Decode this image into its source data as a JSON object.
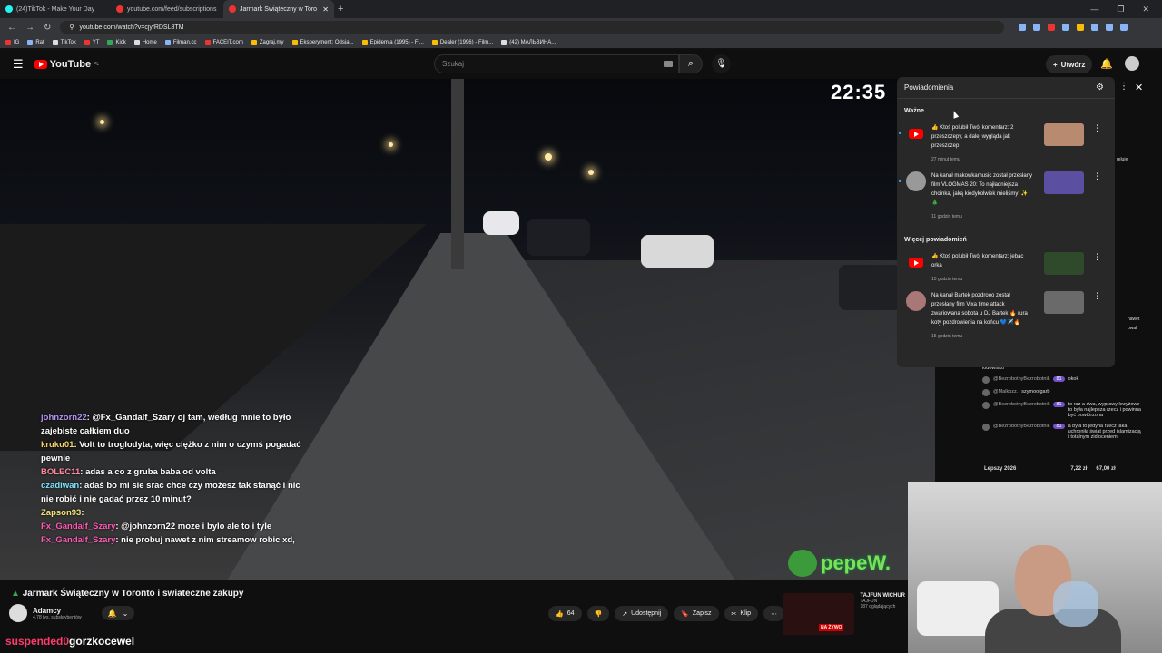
{
  "browser": {
    "tabs": [
      {
        "label": "(24)TikTok - Make Your Day",
        "active": false
      },
      {
        "label": "youtube.com/feed/subscriptions",
        "active": false
      },
      {
        "label": "Jarmark Świąteczny w Toro",
        "active": true
      }
    ],
    "url": "youtube.com/watch?v=cjyfRDSL8TM",
    "bookmarks": [
      "IG",
      "Rat",
      "TikTok",
      "YT",
      "Kick",
      "Home",
      "Filman.cc",
      "FACEIT.com",
      "Zagraj.my",
      "Eksperyment: Odsia...",
      "Epidemia (1995) - Fi...",
      "Dealer (1996) - Film...",
      "(42) МАЛЬВИНА..."
    ]
  },
  "youtube": {
    "logo": "YouTube",
    "region": "PL",
    "search_placeholder": "Szukaj",
    "create_label": "Utwórz"
  },
  "video": {
    "clock": "22:35",
    "title": "Jarmark Świąteczny w Toronto i swiateczne zakupy",
    "channel": "Adamcy",
    "subscribers": "4,78 tys. subskrybentów",
    "likes": "64",
    "share_label": "Udostępnij",
    "save_label": "Zapisz",
    "clip_label": "Klip",
    "pepe_text": "pepeW."
  },
  "stream_chat": [
    {
      "user": "johnzorn22",
      "msg": ": @Fx_Gandalf_Szary oj tam, według mnie to było zajebiste całkiem duo",
      "cls": "n1"
    },
    {
      "user": "kruku01",
      "msg": ": Volt to troglodyta, więc ciężko z nim o czymś pogadać pewnie",
      "cls": "n2"
    },
    {
      "user": "BOLEC11",
      "msg": ": adas a co z gruba baba od volta",
      "cls": "n3"
    },
    {
      "user": "czadiwan",
      "msg": ": adaś bo mi sie srac chce czy możesz tak stanąć i nic nie robić i nie gadać przez 10 minut?",
      "cls": "n4"
    },
    {
      "user": "Zapson93",
      "msg": ":",
      "cls": "n5"
    },
    {
      "user": "Fx_Gandalf_Szary",
      "msg": ": @johnzorn22 moze i bylo ale to i tyle",
      "cls": "n6"
    },
    {
      "user": "Fx_Gandalf_Szary",
      "msg": ": nie probuj nawet z nim streamow robic xd,",
      "cls": "n6"
    }
  ],
  "notifications": {
    "title": "Powiadomienia",
    "section_important": "Ważne",
    "section_more": "Więcej powiadomień",
    "items_important": [
      {
        "text": "👍 Ktoś polubił Twój komentarz: 2 przeszczepy, a dalej wygląda jak przeszczep",
        "time": "27 minut temu",
        "icon": "youtube-logo-icon"
      },
      {
        "text": "Na kanał makowkamusic został przesłany film VLOGMAS 20: To najładniejsza choinka, jaką kiedykolwiek mieliśmy! ✨🎄",
        "time": "11 godzin temu",
        "icon": "channel-avatar-icon"
      }
    ],
    "items_more": [
      {
        "text": "👍 Ktoś polubił Twój komentarz: jebac orka",
        "time": "15 godzin temu",
        "icon": "youtube-logo-icon"
      },
      {
        "text": "Na kanał Bartek pozdrooo został przesłany film Vixa time attack zwariowana sobota u DJ Bartek 🔥 rura koty pozdrowienia na końcu 💙✈️🔥",
        "time": "15 godzin temu",
        "icon": "channel-avatar-icon"
      }
    ]
  },
  "side_chat": [
    {
      "user": "",
      "badge": "",
      "msg": "lodowisko"
    },
    {
      "user": "@BezrobotnyBezrobotnik",
      "badge": "81",
      "msg": "okok"
    },
    {
      "user": "@Malkozz.",
      "badge": "",
      "msg": "szymoolgarb"
    },
    {
      "user": "@BezrobotnyBezrobotnik",
      "badge": "81",
      "msg": "to raz a dwa, wyprawy krzyżowe to była najlepsza rzecz i powinna być powtórzona"
    },
    {
      "user": "@BezrobotnyBezrobotnik",
      "badge": "81",
      "msg": "a była to jedyna rzecz jaka uchroniła świat przed islamizacją i totalnym zidioceniem"
    }
  ],
  "side_labels": {
    "reluje": "reluje",
    "nawet": "nawet",
    "owal": "owal",
    "na": "na"
  },
  "price_bar": {
    "left": "Lepszy 2026",
    "mid": "7,22 zł",
    "right": "67,00 zł"
  },
  "recommended": {
    "title": "TAJFUN WICHUR",
    "channel": "TAJFUN",
    "viewers": "187 oglądających",
    "live_badge": "NA ŻYWO"
  },
  "overlay": {
    "left": "suspended0",
    "right": "gorzkocewel"
  }
}
